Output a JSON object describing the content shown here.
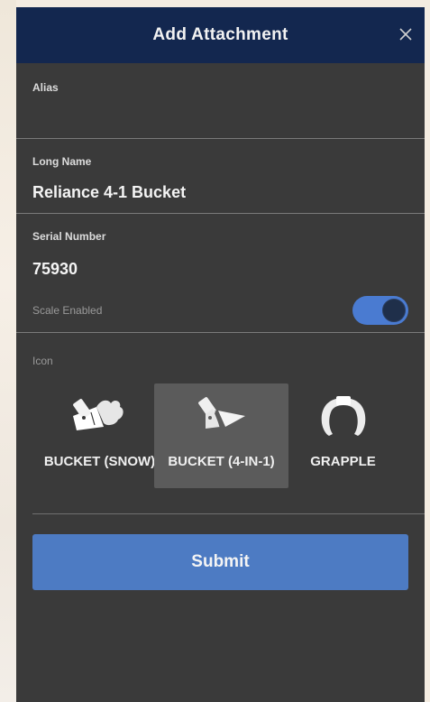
{
  "dialog": {
    "title": "Add Attachment"
  },
  "fields": {
    "alias": {
      "label": "Alias",
      "value": ""
    },
    "long_name": {
      "label": "Long Name",
      "value": "Reliance 4-1 Bucket"
    },
    "serial_number": {
      "label": "Serial Number",
      "value": "75930"
    },
    "scale_enabled": {
      "label": "Scale Enabled",
      "on": true
    }
  },
  "icon_section": {
    "label": "Icon",
    "options": [
      {
        "label": "BUCKET (SNOW)",
        "icon": "bucket-snow-icon",
        "selected": false
      },
      {
        "label": "BUCKET (4-IN-1)",
        "icon": "bucket-4in1-icon",
        "selected": true
      },
      {
        "label": "GRAPPLE",
        "icon": "grapple-icon",
        "selected": false
      }
    ]
  },
  "actions": {
    "submit_label": "Submit"
  },
  "colors": {
    "header": "#13274f",
    "panel": "#3a3a3a",
    "accent": "#4d7bc3",
    "toggle_on": "#4a7bd1"
  }
}
